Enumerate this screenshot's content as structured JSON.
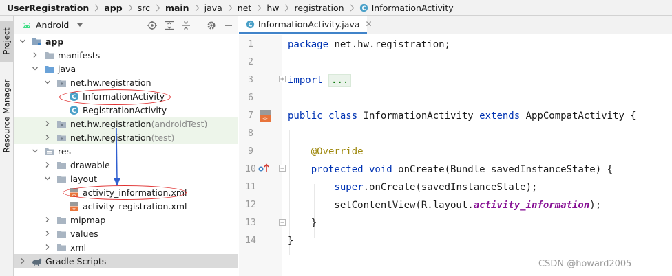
{
  "breadcrumb": [
    {
      "label": "UserRegistration",
      "bold": true
    },
    {
      "label": "app",
      "bold": true
    },
    {
      "label": "src",
      "bold": false
    },
    {
      "label": "main",
      "bold": true
    },
    {
      "label": "java",
      "bold": false
    },
    {
      "label": "net",
      "bold": false
    },
    {
      "label": "hw",
      "bold": false
    },
    {
      "label": "registration",
      "bold": false
    },
    {
      "label": "InformationActivity",
      "bold": false,
      "icon": "class-icon"
    }
  ],
  "stripe": {
    "project": "Project",
    "resource_manager": "Resource Manager"
  },
  "project_view": {
    "selected_view": "Android",
    "toolbar_icons": [
      "locate-icon",
      "expand-all-icon",
      "collapse-all-icon",
      "settings-icon",
      "hide-icon"
    ]
  },
  "tree": [
    {
      "label": "app",
      "depth": 0,
      "expanded": true,
      "icon": "module-folder-icon",
      "bold": true
    },
    {
      "label": "manifests",
      "depth": 1,
      "expanded": false,
      "icon": "folder-icon"
    },
    {
      "label": "java",
      "depth": 1,
      "expanded": true,
      "icon": "source-folder-icon"
    },
    {
      "label": "net.hw.registration",
      "depth": 2,
      "expanded": true,
      "icon": "package-icon"
    },
    {
      "label": "InformationActivity",
      "depth": 3,
      "leaf": true,
      "icon": "class-icon"
    },
    {
      "label": "RegistrationActivity",
      "depth": 3,
      "leaf": true,
      "icon": "class-icon"
    },
    {
      "label": "net.hw.registration",
      "hint": "(androidTest)",
      "depth": 2,
      "expanded": false,
      "icon": "package-icon",
      "test": true
    },
    {
      "label": "net.hw.registration",
      "hint": "(test)",
      "depth": 2,
      "expanded": false,
      "icon": "package-icon",
      "test": true
    },
    {
      "label": "res",
      "depth": 1,
      "expanded": true,
      "icon": "res-folder-icon"
    },
    {
      "label": "drawable",
      "depth": 2,
      "expanded": false,
      "icon": "folder-icon"
    },
    {
      "label": "layout",
      "depth": 2,
      "expanded": true,
      "icon": "folder-icon"
    },
    {
      "label": "activity_information.xml",
      "depth": 3,
      "leaf": true,
      "icon": "xml-file-icon"
    },
    {
      "label": "activity_registration.xml",
      "depth": 3,
      "leaf": true,
      "icon": "xml-file-icon"
    },
    {
      "label": "mipmap",
      "depth": 2,
      "expanded": false,
      "icon": "folder-icon"
    },
    {
      "label": "values",
      "depth": 2,
      "expanded": false,
      "icon": "folder-icon"
    },
    {
      "label": "xml",
      "depth": 2,
      "expanded": false,
      "icon": "folder-icon"
    },
    {
      "label": "Gradle Scripts",
      "depth": 0,
      "expanded": false,
      "icon": "gradle-icon",
      "gradle": true
    }
  ],
  "editor": {
    "tab_label": "InformationActivity.java",
    "lines": [
      {
        "n": "1",
        "tokens": [
          {
            "t": "package ",
            "c": "kw"
          },
          {
            "t": "net.hw.registration;",
            "c": ""
          }
        ]
      },
      {
        "n": "2",
        "tokens": []
      },
      {
        "n": "3",
        "tokens": [
          {
            "t": "import ",
            "c": "kw"
          },
          {
            "t": "...",
            "c": "fold-dots"
          }
        ]
      },
      {
        "n": "6",
        "tokens": []
      },
      {
        "n": "7",
        "tokens": [
          {
            "t": "public class ",
            "c": "kw"
          },
          {
            "t": "InformationActivity ",
            "c": ""
          },
          {
            "t": "extends ",
            "c": "kw"
          },
          {
            "t": "AppCompatActivity {",
            "c": ""
          }
        ]
      },
      {
        "n": "8",
        "tokens": []
      },
      {
        "n": "9",
        "tokens": [
          {
            "t": "    ",
            "c": ""
          },
          {
            "t": "@Override",
            "c": "ann"
          }
        ]
      },
      {
        "n": "10",
        "tokens": [
          {
            "t": "    ",
            "c": ""
          },
          {
            "t": "protected void ",
            "c": "kw"
          },
          {
            "t": "onCreate(Bundle savedInstanceState) {",
            "c": ""
          }
        ]
      },
      {
        "n": "11",
        "tokens": [
          {
            "t": "        ",
            "c": ""
          },
          {
            "t": "super",
            "c": "kw"
          },
          {
            "t": ".onCreate(savedInstanceState);",
            "c": ""
          }
        ]
      },
      {
        "n": "12",
        "tokens": [
          {
            "t": "        setContentView(R.layout.",
            "c": ""
          },
          {
            "t": "activity_information",
            "c": "ital"
          },
          {
            "t": ");",
            "c": ""
          }
        ]
      },
      {
        "n": "13",
        "tokens": [
          {
            "t": "    }",
            "c": ""
          }
        ]
      },
      {
        "n": "14",
        "tokens": [
          {
            "t": "}",
            "c": ""
          }
        ]
      }
    ]
  },
  "watermark": "CSDN @howard2005",
  "colors": {
    "annotation_ellipse": "#e03030",
    "annotation_arrow": "#2f5fd0",
    "keyword": "#0033b3",
    "class_icon": "#4aa0c8"
  }
}
